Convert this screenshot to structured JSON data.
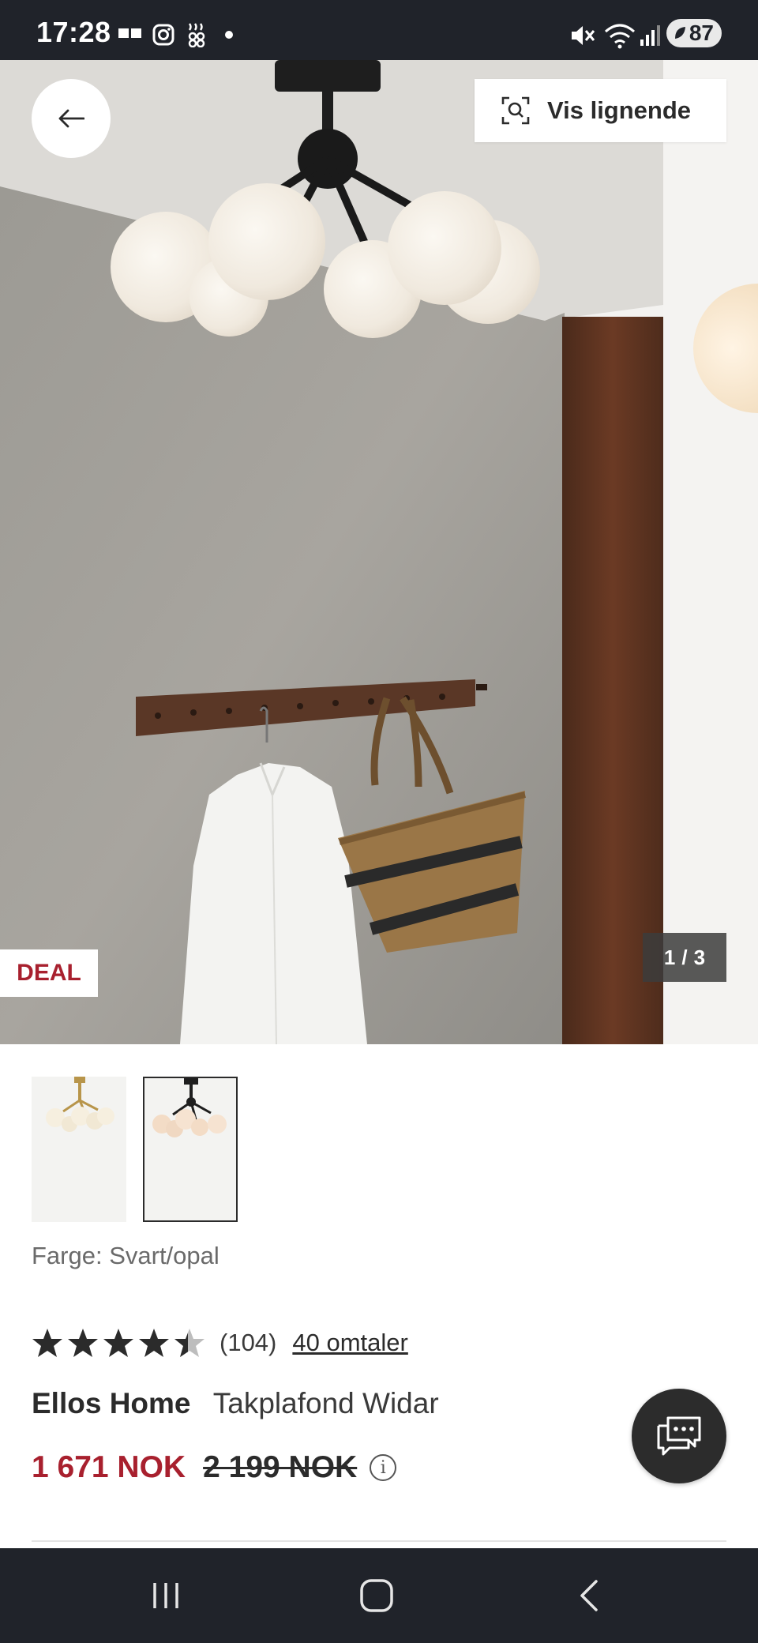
{
  "status_bar": {
    "time": "17:28",
    "battery": "87",
    "icons": [
      "messaging-icon",
      "instagram-icon",
      "app-icon",
      "dot-icon",
      "mute-icon",
      "wifi-icon",
      "signal-icon"
    ]
  },
  "hero": {
    "similar_label": "Vis lignende",
    "deal_label": "DEAL",
    "pager": {
      "current": "1",
      "sep": "/",
      "total": "3"
    }
  },
  "thumbnails": [
    {
      "name": "brass-variant-thumbnail",
      "selected": false
    },
    {
      "name": "black-variant-thumbnail",
      "selected": true
    }
  ],
  "product": {
    "color_label": "Farge: Svart/opal",
    "rating": {
      "stars": 4.5,
      "count": "(104)",
      "reviews_link": "40 omtaler"
    },
    "brand": "Ellos Home",
    "name": "Takplafond Widar",
    "price_now": "1 671 NOK",
    "price_was": "2 199 NOK",
    "info_symbol": "i"
  },
  "colors": {
    "accent_red": "#a8202e",
    "dark": "#20232a",
    "text": "#2b2b2b",
    "muted": "#6a6a6a"
  }
}
